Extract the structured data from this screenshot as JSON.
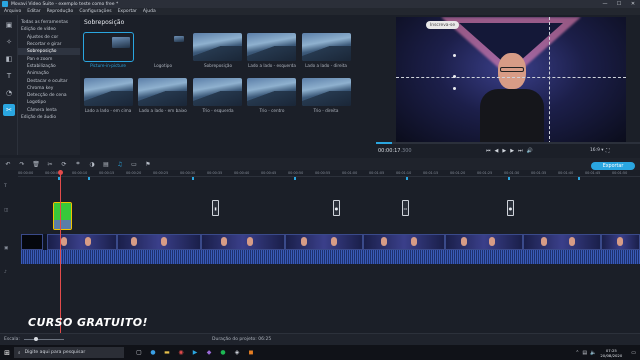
{
  "titlebar": {
    "title": "Movavi Video Suite - exemplo teste como free *",
    "min": "—",
    "max": "☐",
    "close": "✕"
  },
  "menu": [
    "Arquivo",
    "Editar",
    "Reprodução",
    "Configurações",
    "Exportar",
    "Ajuda"
  ],
  "categories": [
    {
      "label": "Todas as ferramentas"
    },
    {
      "label": "Edição de vídeo"
    },
    {
      "label": "Ajustes de cor"
    },
    {
      "label": "Recortar e girar"
    },
    {
      "label": "Sobreposição"
    },
    {
      "label": "Pan e zoom"
    },
    {
      "label": "Estabilização"
    },
    {
      "label": "Animação"
    },
    {
      "label": "Destacar e ocultar"
    },
    {
      "label": "Chroma key"
    },
    {
      "label": "Detecção de cena"
    },
    {
      "label": "Logotipo"
    },
    {
      "label": "Câmera lenta"
    },
    {
      "label": "Edição de áudio"
    }
  ],
  "effects": {
    "heading": "Sobreposição",
    "items": [
      {
        "label": "Picture-in-picture",
        "active": true
      },
      {
        "label": "Logotipo"
      },
      {
        "label": "Sobreposição"
      },
      {
        "label": "Lado a lado - esquerda"
      },
      {
        "label": "Lado a lado - direita"
      },
      {
        "label": "Lado a lado - em cima"
      },
      {
        "label": "Lado a lado - em baixo"
      },
      {
        "label": "Trio - esquerda"
      },
      {
        "label": "Trio - centro"
      },
      {
        "label": "Trio - direita"
      }
    ]
  },
  "preview": {
    "badge": "Inscreva-se",
    "time_current": "00:00:17",
    "time_ms": ".300",
    "ratio": "16:9 ▾",
    "progress": 0.06,
    "controls": [
      "⏮",
      "◀",
      "▶",
      "▶",
      "⏭",
      "🔊"
    ]
  },
  "toolbar": {
    "export_label": "Exportar"
  },
  "ruler_ticks": [
    "00:00:00",
    "00:00:05",
    "00:00:10",
    "00:00:15",
    "00:00:20",
    "00:00:25",
    "00:00:30",
    "00:00:35",
    "00:00:40",
    "00:00:45",
    "00:00:50",
    "00:00:55",
    "00:01:00",
    "00:01:05",
    "00:01:10",
    "00:01:15",
    "00:01:20",
    "00:01:25",
    "00:01:30",
    "00:01:35",
    "00:01:40",
    "00:01:45",
    "00:01:50"
  ],
  "overlay_text": "CURSO GRATUITO!",
  "status": {
    "scale_label": "Escala:",
    "duration_label": "Duração do projeto:",
    "duration": "06:25"
  },
  "taskbar": {
    "search_placeholder": "Digite aqui para pesquisar",
    "time": "07:25",
    "date": "20/08/2020"
  }
}
